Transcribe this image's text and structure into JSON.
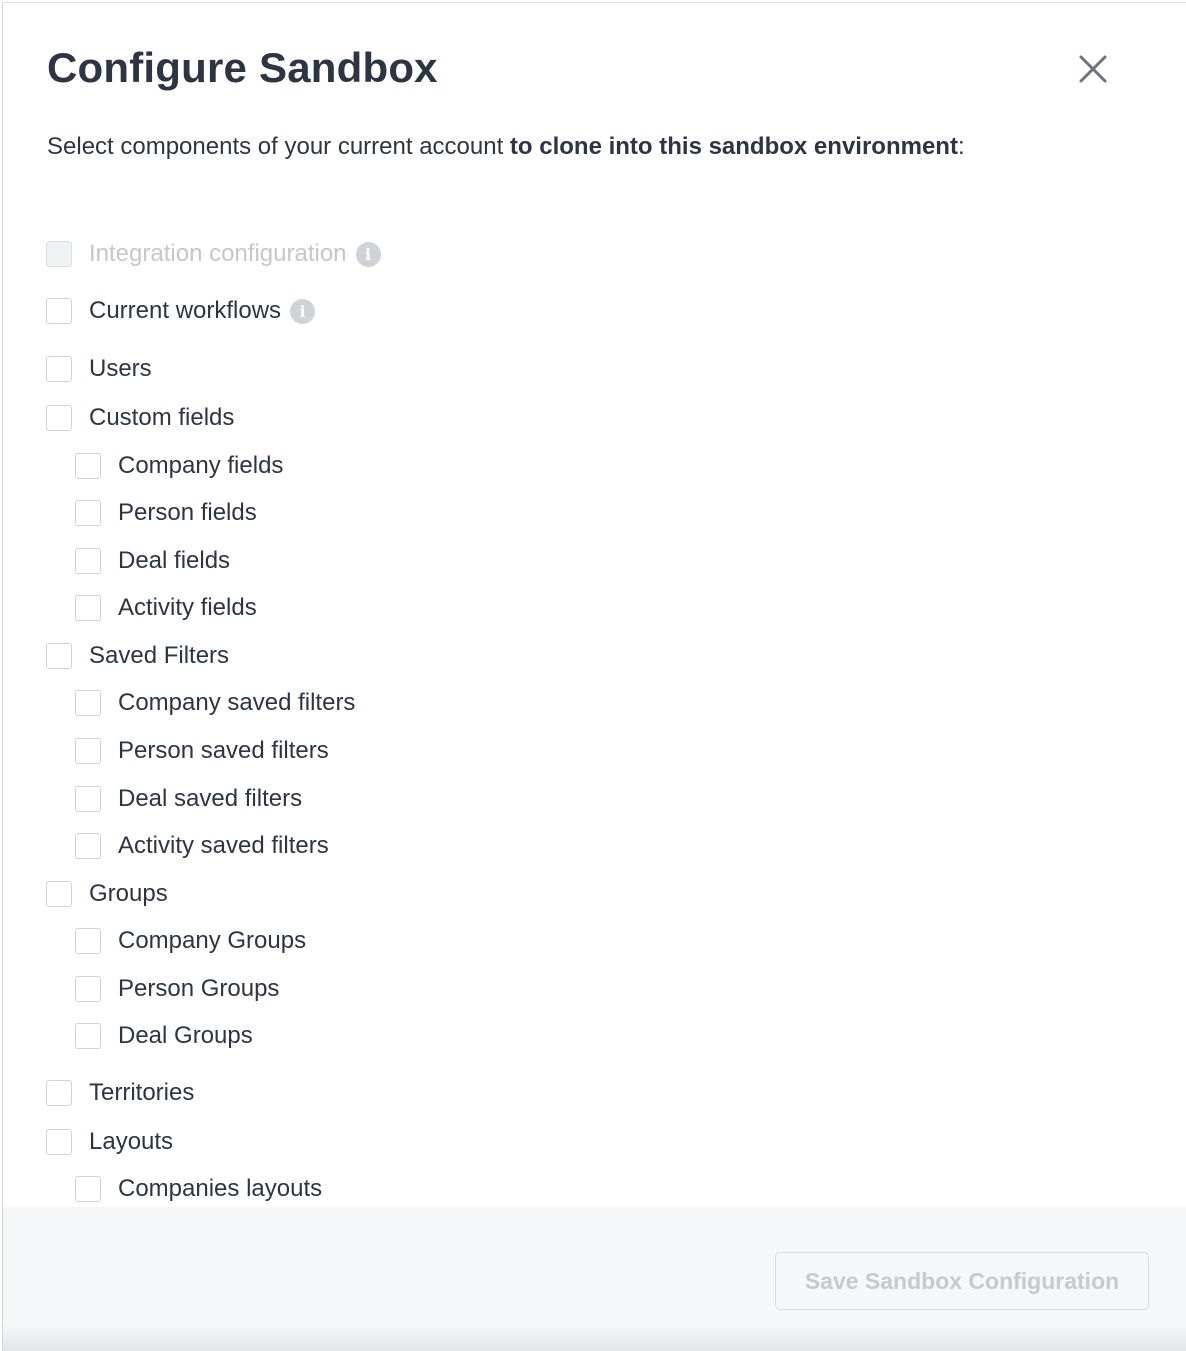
{
  "modal": {
    "title": "Configure Sandbox",
    "subtitle_prefix": "Select components of your current account ",
    "subtitle_bold": "to clone into this sandbox environment",
    "subtitle_suffix": ":",
    "close_icon": "close-icon"
  },
  "options": [
    {
      "label": "Integration configuration",
      "level": 0,
      "disabled": true,
      "info": true
    },
    {
      "label": "Current workflows",
      "level": 0,
      "disabled": false,
      "info": true
    },
    {
      "label": "Users",
      "level": 0
    },
    {
      "label": "Custom fields",
      "level": 0
    },
    {
      "label": "Company fields",
      "level": 1
    },
    {
      "label": "Person fields",
      "level": 1
    },
    {
      "label": "Deal fields",
      "level": 1
    },
    {
      "label": "Activity fields",
      "level": 1
    },
    {
      "label": "Saved Filters",
      "level": 0
    },
    {
      "label": "Company saved filters",
      "level": 1
    },
    {
      "label": "Person saved filters",
      "level": 1
    },
    {
      "label": "Deal saved filters",
      "level": 1
    },
    {
      "label": "Activity saved filters",
      "level": 1
    },
    {
      "label": "Groups",
      "level": 0
    },
    {
      "label": "Company Groups",
      "level": 1
    },
    {
      "label": "Person Groups",
      "level": 1
    },
    {
      "label": "Deal Groups",
      "level": 1
    },
    {
      "label": "Territories",
      "level": 0
    },
    {
      "label": "Layouts",
      "level": 0
    },
    {
      "label": "Companies layouts",
      "level": 1
    }
  ],
  "footer": {
    "save_label": "Save Sandbox Configuration",
    "save_disabled": true
  },
  "colors": {
    "text": "#2e3542",
    "disabled_text": "#c3c7ce",
    "border": "#cfd3d9",
    "footer_bg": "#f6f7f9"
  }
}
